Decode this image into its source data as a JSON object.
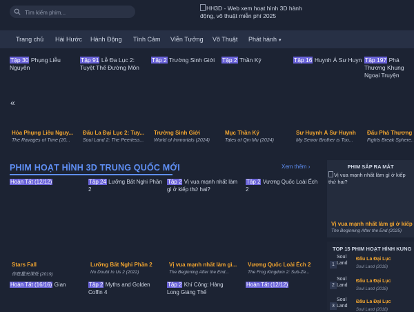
{
  "header": {
    "search_placeholder": "Tìm kiếm phim...",
    "logo_text": "HH3D - Web xem hoạt hình 3D hành động, võ thuật miễn phí 2025"
  },
  "nav": {
    "items": [
      "Trang chủ",
      "Hài Hước",
      "Hành Động",
      "Tình Cảm",
      "Viễn Tưởng",
      "Võ Thuật",
      "Phát hành"
    ]
  },
  "slider": {
    "items": [
      {
        "ep": "Tập 30",
        "ep_alt": "Phụng Liễu Nguyên",
        "title": "Hỏa Phụng Liêu Nguy...",
        "sub": "The Ravages of Time (20..."
      },
      {
        "ep": "Tập 91",
        "ep_alt": "Lễ Đa Lục 2: Tuyệt Thế Đường Môn",
        "title": "Đấu La Đại Lục 2: Tuy...",
        "sub": "Soul Land 2: The Peerless..."
      },
      {
        "ep": "Tập 2",
        "ep_alt": "Trường Sinh Giới",
        "title": "Trường Sinh Giới",
        "sub": "World of Immortals (2024)"
      },
      {
        "ep": "Tập 2",
        "ep_alt": "Thần Ký",
        "title": "Mục Thần Ký",
        "sub": "Tales of Qin Mu (2024)"
      },
      {
        "ep": "Tập 16",
        "ep_alt": "Huynh Á Sư Huynh",
        "title": "Sư Huynh Á Sư Huynh",
        "sub": "My Senior Brother is Too..."
      },
      {
        "ep": "Tập 197",
        "ep_alt": "Phá Thương Khung Ngoại Truyện",
        "title": "Đấu Phá Thương Kh...",
        "sub": "Fights Break Sphere..."
      }
    ]
  },
  "section": {
    "title": "PHIM HOẠT HÌNH 3D TRUNG QUỐC MỚI",
    "see_more": "Xem thêm",
    "cards": [
      {
        "ep": "Hoàn Tất (12/12)",
        "ep_alt": "",
        "title": "Stars Fall",
        "sub": "你在星光深处 (2019)"
      },
      {
        "ep": "Tập 24",
        "ep_alt": "Lưỡng Bất Nghi Phần 2",
        "title": "Lưỡng Bất Nghi Phần 2",
        "sub": "No Doubt In Us 2 (2022)"
      },
      {
        "ep": "Tập 2",
        "ep_alt": "Vị vua mạnh nhất làm gì ở kiếp thứ hai?",
        "title": "Vị vua mạnh nhất làm gì...",
        "sub": "The Beginning After the End..."
      },
      {
        "ep": "Tập 2",
        "ep_alt": "Vương Quốc Loài Ếch 2",
        "title": "Vương Quốc Loài Ếch 2",
        "sub": "The Frog Kingdom 2: Sub-Ze..."
      }
    ],
    "cards2": [
      {
        "ep": "Hoàn Tất (16/16)",
        "ep_alt": "Gian"
      },
      {
        "ep": "Tập 2",
        "ep_alt": "Myths and Golden Coffin 4"
      },
      {
        "ep": "Tập 2",
        "ep_alt": "Khí Công: Hàng Long Giáng Thế"
      },
      {
        "ep": "Hoàn Tất (12/12)",
        "ep_alt": ""
      }
    ]
  },
  "sidebar": {
    "upcoming_head": "PHIM SẮP RA MẮT",
    "upcoming_img_alt": "Vị vua mạnh nhất làm gì ở kiếp thứ hai?",
    "upcoming_title": "Vị vua mạnh nhất làm gì ở kiếp",
    "upcoming_sub": "The Beginning After the End (2025)",
    "top15_head": "TOP 15 PHIM HOẠT HÌNH KUNG",
    "top15": [
      {
        "rank": "1",
        "img_alt": "Soul Land",
        "title": "Đấu La Đại Lục",
        "sub": "Soul Land (2018)"
      },
      {
        "rank": "2",
        "img_alt": "Soul Land",
        "title": "Đấu La Đại Lục",
        "sub": "Soul Land (2018)"
      },
      {
        "rank": "3",
        "img_alt": "Soul Land",
        "title": "Đấu La Đại Lục",
        "sub": "Soul Land (2018)"
      }
    ]
  },
  "colors": {
    "background": "#1c2333",
    "nav": "#273045",
    "accent_blue": "#5f8ff4",
    "accent_orange": "#f0a430",
    "badge": "#6a63d8"
  },
  "icons": {
    "search": "search-icon",
    "prev": "double-chevron-left-icon",
    "caret": "chevron-down-icon"
  }
}
